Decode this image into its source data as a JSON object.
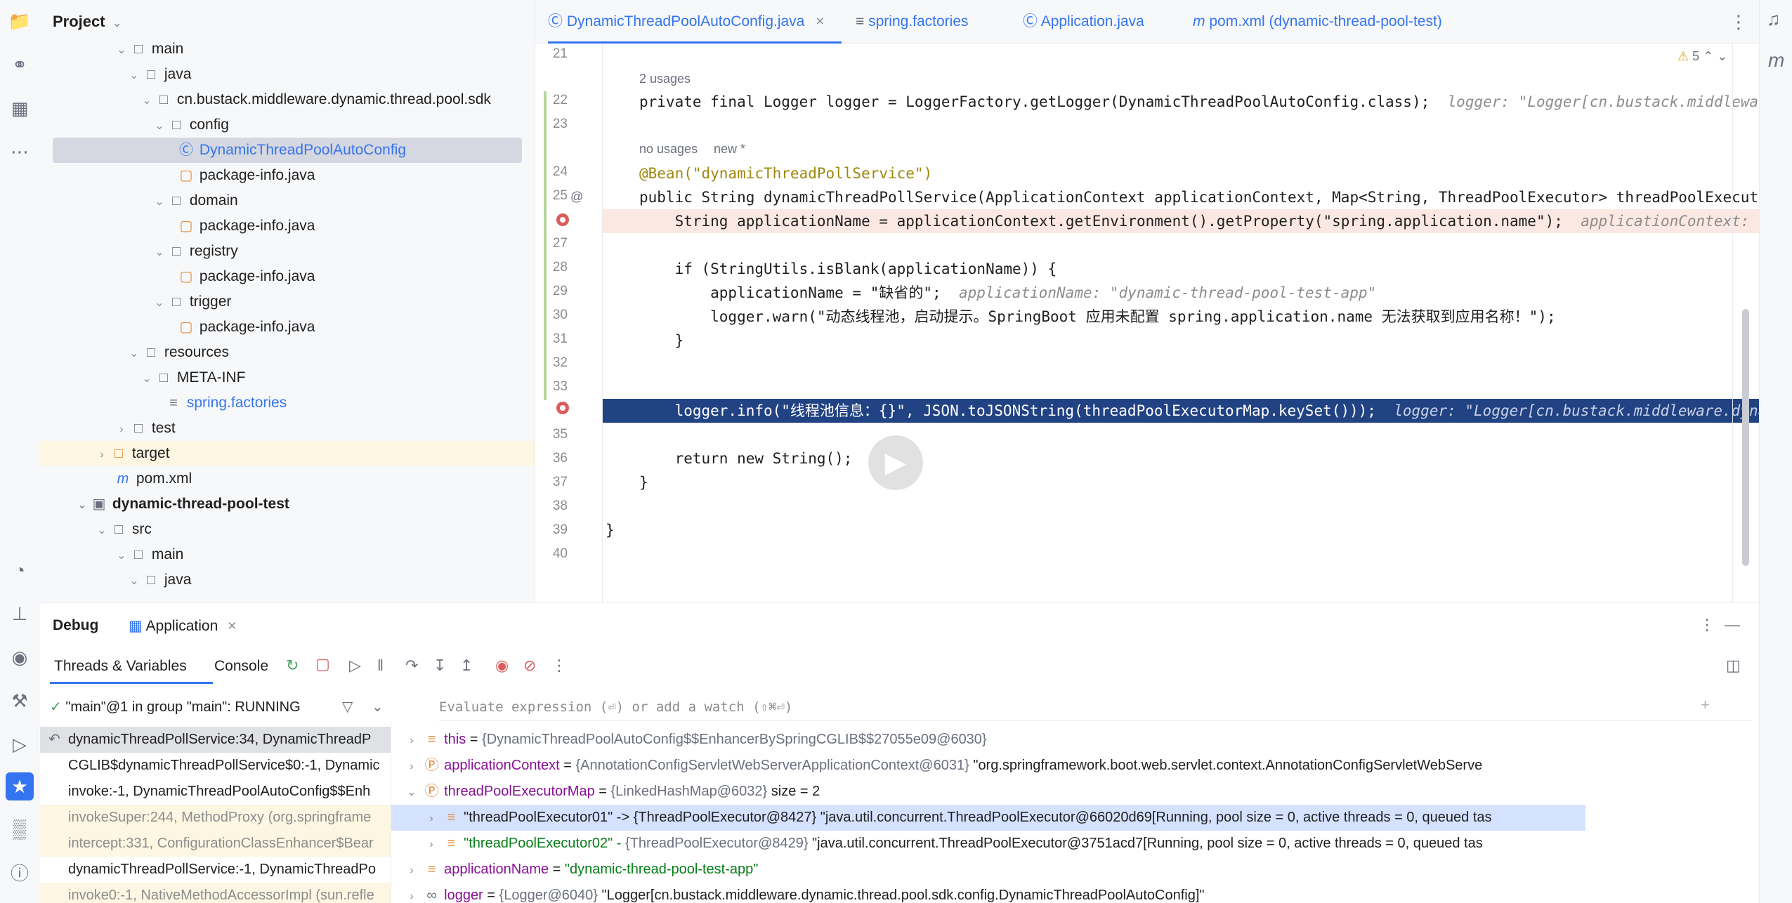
{
  "project": {
    "title": "Project",
    "tree": [
      {
        "label": "main",
        "kind": "folder",
        "indent": 0
      },
      {
        "label": "java",
        "kind": "folder",
        "indent": 1
      },
      {
        "label": "cn.bustack.middleware.dynamic.thread.pool.sdk",
        "kind": "folder",
        "indent": 2
      },
      {
        "label": "config",
        "kind": "folder",
        "indent": 3
      },
      {
        "label": "DynamicThreadPoolAutoConfig",
        "kind": "class",
        "indent": 4
      },
      {
        "label": "package-info.java",
        "kind": "pkg",
        "indent": 4
      },
      {
        "label": "domain",
        "kind": "folder",
        "indent": 3
      },
      {
        "label": "package-info.java",
        "kind": "pkg",
        "indent": 4
      },
      {
        "label": "registry",
        "kind": "folder",
        "indent": 3
      },
      {
        "label": "package-info.java",
        "kind": "pkg",
        "indent": 4
      },
      {
        "label": "trigger",
        "kind": "folder",
        "indent": 3
      },
      {
        "label": "package-info.java",
        "kind": "pkg",
        "indent": 4
      },
      {
        "label": "resources",
        "kind": "folder",
        "indent": 1
      },
      {
        "label": "META-INF",
        "kind": "folder",
        "indent": 2
      },
      {
        "label": "spring.factories",
        "kind": "file",
        "indent": 3
      },
      {
        "label": "test",
        "kind": "folder",
        "indent": 0
      },
      {
        "label": "target",
        "kind": "folder",
        "indent": -1
      },
      {
        "label": "pom.xml",
        "kind": "xml",
        "indent": -1
      },
      {
        "label": "dynamic-thread-pool-test",
        "kind": "module",
        "indent": -2
      },
      {
        "label": "src",
        "kind": "folder",
        "indent": -1
      },
      {
        "label": "main",
        "kind": "folder",
        "indent": 0
      },
      {
        "label": "java",
        "kind": "folder",
        "indent": 1
      }
    ]
  },
  "tabs": [
    {
      "label": "DynamicThreadPoolAutoConfig.java"
    },
    {
      "label": "spring.factories"
    },
    {
      "label": "Application.java"
    },
    {
      "label": "pom.xml (dynamic-thread-pool-test)"
    }
  ],
  "editor": {
    "warnings": "5",
    "usages_22": "2 usages",
    "usages_25_a": "no usages",
    "usages_25_b": "new *",
    "line_numbers": [
      "21",
      "22",
      "23",
      "24",
      "25",
      "26",
      "27",
      "28",
      "29",
      "30",
      "31",
      "32",
      "33",
      "34",
      "35",
      "36",
      "37",
      "38",
      "39",
      "40"
    ],
    "line22": "private final Logger logger = LoggerFactory.getLogger(DynamicThreadPoolAutoConfig.class);",
    "line22_inlay": "logger: \"Logger[cn.bustack.middleware.dyna",
    "line24": "@Bean(\"dynamicThreadPollService\")",
    "line25": "public String dynamicThreadPollService(ApplicationContext applicationContext, Map<String, ThreadPoolExecutor> threadPoolExecutorMa",
    "line26": "    String applicationName = applicationContext.getEnvironment().getProperty(\"spring.application.name\");",
    "line26_inlay": "applicationContext: \"org",
    "line28": "    if (StringUtils.isBlank(applicationName)) {",
    "line29": "        applicationName = \"缺省的\";",
    "line29_inlay": "applicationName: \"dynamic-thread-pool-test-app\"",
    "line30": "        logger.warn(\"动态线程池，启动提示。SpringBoot 应用未配置 spring.application.name 无法获取到应用名称！\");",
    "line31": "    }",
    "line34": "    logger.info(\"线程池信息：{}\", JSON.toJSONString(threadPoolExecutorMap.keySet()));",
    "line34_inlay": "logger: \"Logger[cn.bustack.middleware.dynami",
    "line36": "    return new String();",
    "line37": "}",
    "line39": "}"
  },
  "debug": {
    "title": "Debug",
    "session_tab": "Application",
    "sub_tabs": [
      "Threads & Variables",
      "Console"
    ],
    "thread": "\"main\"@1 in group \"main\": RUNNING",
    "eval_placeholder": "Evaluate expression (⏎) or add a watch (⇧⌘⏎)",
    "frames": [
      {
        "label": "dynamicThreadPollService:34, DynamicThreadP",
        "kind": "cur"
      },
      {
        "label": "CGLIB$dynamicThreadPollService$0:-1, Dynamic",
        "kind": "app"
      },
      {
        "label": "invoke:-1, DynamicThreadPoolAutoConfig$$Enh",
        "kind": "app"
      },
      {
        "label": "invokeSuper:244, MethodProxy (org.springframe",
        "kind": "lib"
      },
      {
        "label": "intercept:331, ConfigurationClassEnhancer$Bear",
        "kind": "lib"
      },
      {
        "label": "dynamicThreadPollService:-1, DynamicThreadPo",
        "kind": "app"
      },
      {
        "label": "invoke0:-1, NativeMethodAccessorImpl (sun.refle",
        "kind": "lib"
      }
    ],
    "variables": [
      {
        "name": "this",
        "eq": " = ",
        "type": "{DynamicThreadPoolAutoConfig$$EnhancerBySpringCGLIB$$27055e09@6030}",
        "value": ""
      },
      {
        "name": "applicationContext",
        "eq": " = ",
        "type": "{AnnotationConfigServletWebServerApplicationContext@6031}",
        "value": " \"org.springframework.boot.web.servlet.context.AnnotationConfigServletWebServe"
      },
      {
        "name": "threadPoolExecutorMap",
        "eq": " = ",
        "type": "{LinkedHashMap@6032}",
        "value": "  size = 2"
      },
      {
        "name": "\"threadPoolExecutor01\" -> {ThreadPoolExecutor@8427}",
        "eq": " ",
        "type": "",
        "value": "\"java.util.concurrent.ThreadPoolExecutor@66020d69[Running, pool size = 0, active threads = 0, queued tas"
      },
      {
        "name": "\"threadPoolExecutor02\" -",
        "eq": " ",
        "type": "{ThreadPoolExecutor@8429}",
        "value": " \"java.util.concurrent.ThreadPoolExecutor@3751acd7[Running, pool size = 0, active threads = 0, queued tas"
      },
      {
        "name": "applicationName",
        "eq": " = ",
        "type": "",
        "value": "\"dynamic-thread-pool-test-app\""
      },
      {
        "name": "logger",
        "eq": " = ",
        "type": "{Logger@6040}",
        "value": " \"Logger[cn.bustack.middleware.dynamic.thread.pool.sdk.config.DynamicThreadPoolAutoConfig]\""
      }
    ]
  },
  "colors": {
    "accent": "#3574f0",
    "selection_line": "#214283",
    "breakpoint": "#db5c5c",
    "exec_line": "#fce8e2"
  }
}
